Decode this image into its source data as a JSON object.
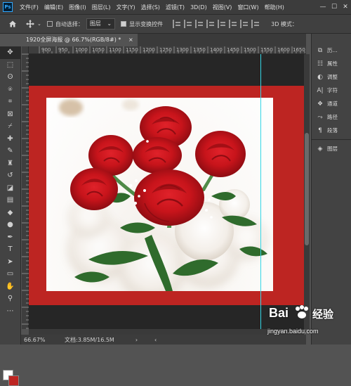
{
  "app": {
    "logo": "Ps"
  },
  "menu": [
    "文件(F)",
    "编辑(E)",
    "图像(I)",
    "图层(L)",
    "文字(Y)",
    "选择(S)",
    "滤镜(T)",
    "3D(D)",
    "视图(V)",
    "窗口(W)",
    "帮助(H)"
  ],
  "options": {
    "auto_select_label": "自动选择：",
    "auto_select_value": "图层",
    "show_transform_label": "显示变换控件",
    "mode_3d_label": "3D 模式："
  },
  "document": {
    "tab_title": "1920全屏海报 @ 66.7%(RGB/8#) *",
    "close_glyph": "×"
  },
  "ruler": {
    "h_ticks": [
      "900",
      "950",
      "1000",
      "1050",
      "1100",
      "1150",
      "1200",
      "1250",
      "1300",
      "1350",
      "1400",
      "1450",
      "1500",
      "1550",
      "1600",
      "1650"
    ]
  },
  "status": {
    "zoom": "66.67%",
    "doc_size": "文档:3.85M/16.5M"
  },
  "panels": [
    {
      "icon": "history-icon",
      "label": "历..."
    },
    {
      "icon": "properties-icon",
      "label": "属性"
    },
    {
      "icon": "adjustments-icon",
      "label": "调整"
    },
    {
      "icon": "character-icon",
      "label": "字符"
    },
    {
      "icon": "channels-icon",
      "label": "通道"
    },
    {
      "icon": "paths-icon",
      "label": "路径"
    },
    {
      "icon": "paragraph-icon",
      "label": "段落"
    },
    {
      "icon": "layers-icon",
      "label": "图层"
    }
  ],
  "watermark": {
    "text": "Bai",
    "brand": "经验",
    "url": "jingyan.baidu.com"
  },
  "colors": {
    "background_red": "#bd2522",
    "rose_red": "#c8141b",
    "guide": "#33d6e6",
    "foreground_swatch": "#ffffff"
  }
}
